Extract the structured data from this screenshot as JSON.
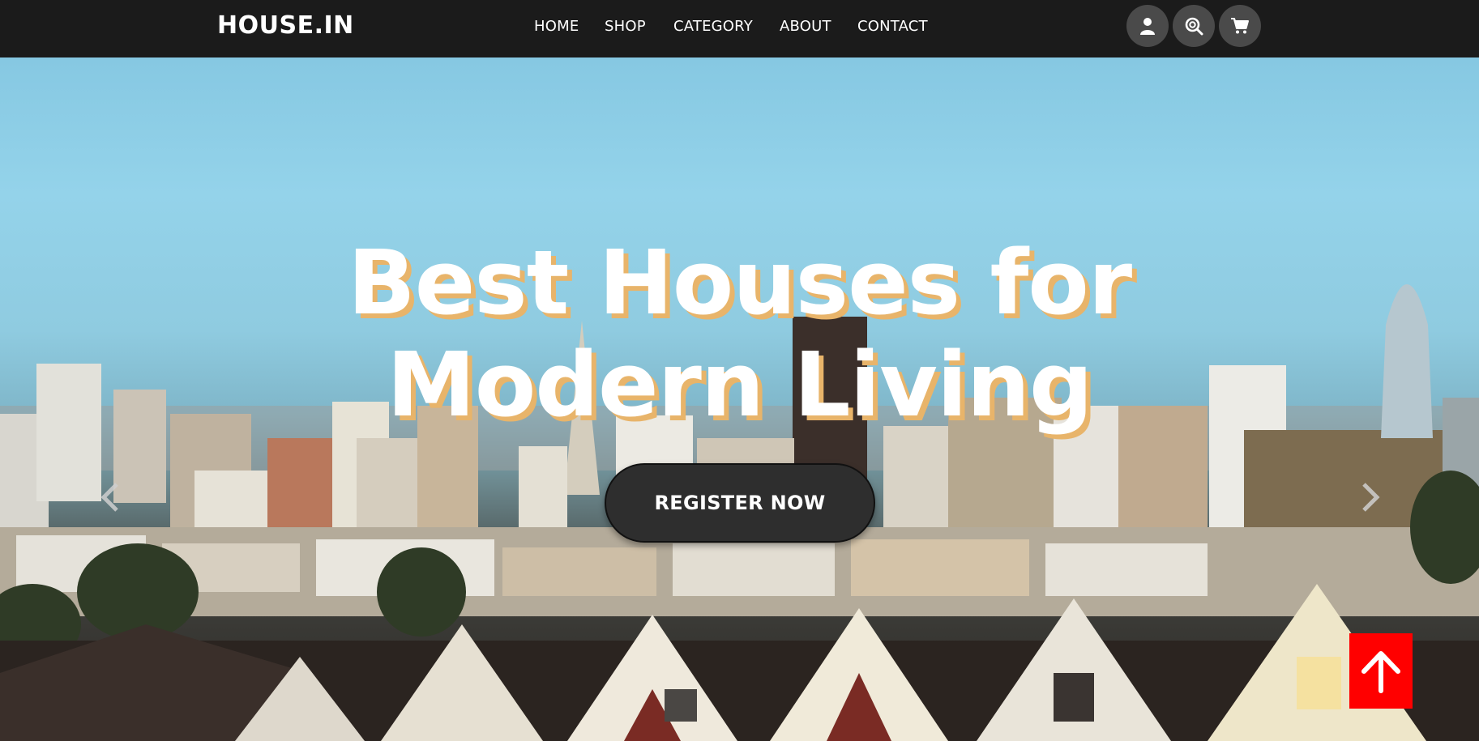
{
  "brand": {
    "name": "HOUSE.IN"
  },
  "nav": {
    "links": [
      "HOME",
      "SHOP",
      "CATEGORY",
      "ABOUT",
      "CONTACT"
    ],
    "icons": [
      "user-icon",
      "search-icon",
      "cart-icon"
    ]
  },
  "hero": {
    "title": "Best Houses for\nModern Living",
    "cta_label": "REGISTER NOW"
  },
  "colors": {
    "navbar_bg": "#1b1b1b",
    "icon_button_bg": "#4a4a4a",
    "title_shadow": "#e8b46a",
    "cta_bg": "#2e2e2e",
    "back_to_top_bg": "#ff0000"
  }
}
